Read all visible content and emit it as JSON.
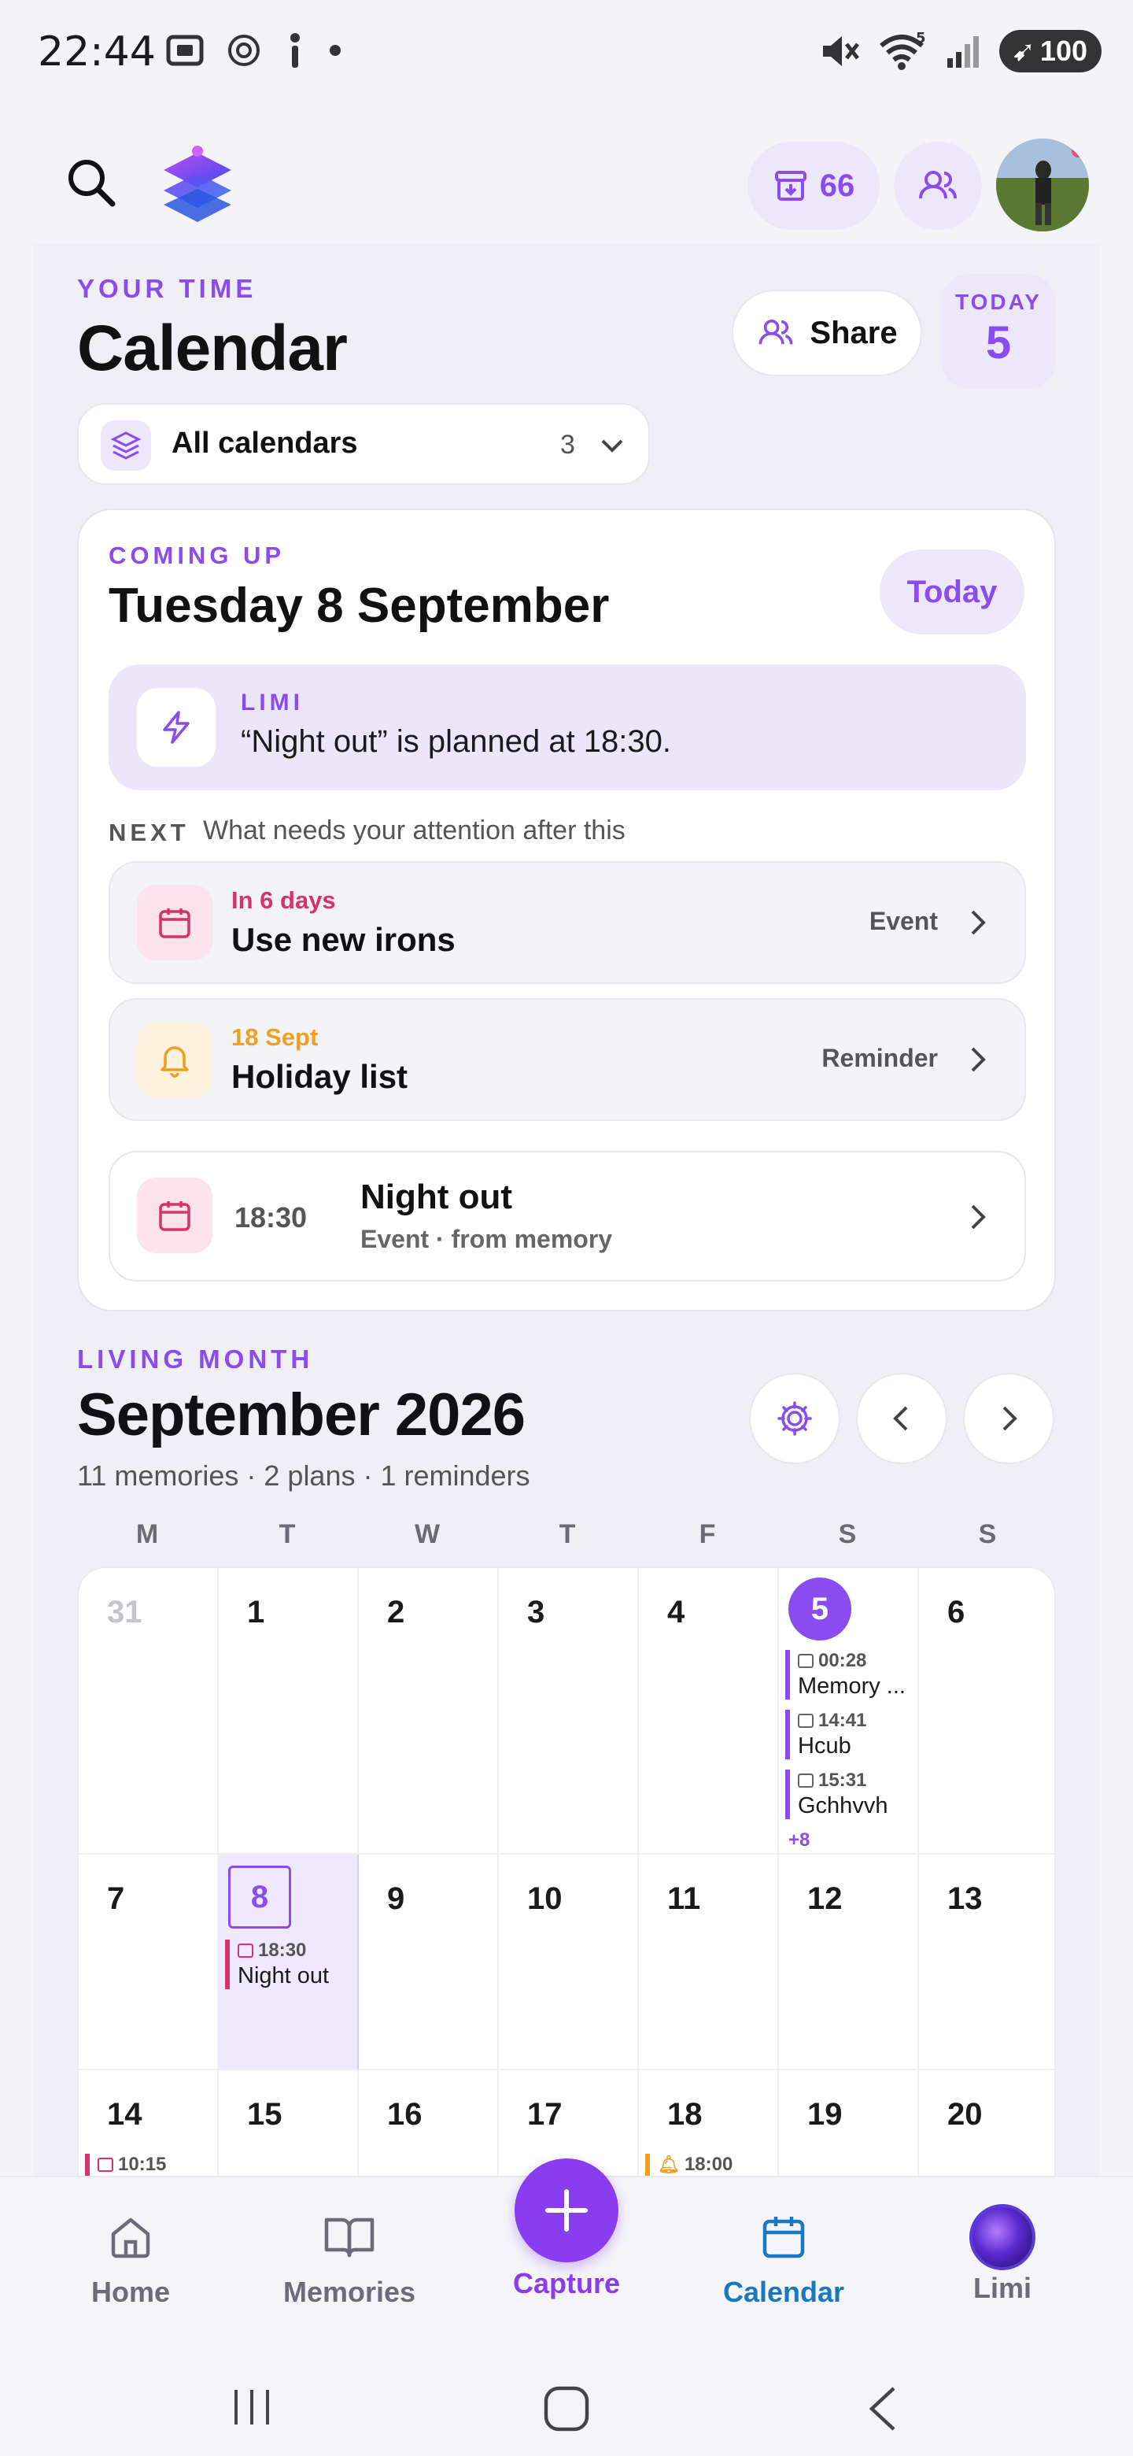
{
  "status": {
    "time": "22:44",
    "battery": "100",
    "wifi_badge": "5"
  },
  "header": {
    "archive_count": "66"
  },
  "hero": {
    "eyebrow": "YOUR TIME",
    "title": "Calendar",
    "share_label": "Share",
    "today_label": "TODAY",
    "today_num": "5",
    "calendar_selector": {
      "label": "All calendars",
      "count": "3"
    }
  },
  "coming_up": {
    "eyebrow": "COMING UP",
    "date": "Tuesday 8 September",
    "today_button": "Today",
    "limi": {
      "label": "LIMI",
      "message": "“Night out” is planned at 18:30."
    },
    "next_label": "NEXT",
    "next_sub": "What needs your attention after this",
    "items": [
      {
        "when": "In 6 days",
        "title": "Use new irons",
        "kind": "Event",
        "color": "#d6336c",
        "icon": "calendar-icon"
      },
      {
        "when": "18 Sept",
        "title": "Holiday list",
        "kind": "Reminder",
        "color": "#f0a020",
        "icon": "bell-icon"
      }
    ],
    "featured": {
      "time": "18:30",
      "title": "Night out",
      "sub": "Event · from memory"
    }
  },
  "living_month": {
    "eyebrow": "LIVING MONTH",
    "title": "September 2026",
    "summary": "11 memories · 2 plans · 1 reminders",
    "weekdays": [
      "M",
      "T",
      "W",
      "T",
      "F",
      "S",
      "S"
    ],
    "week1": [
      "31",
      "1",
      "2",
      "3",
      "4",
      "5",
      "6"
    ],
    "week2": [
      "7",
      "8",
      "9",
      "10",
      "11",
      "12",
      "13"
    ],
    "week3": [
      "14",
      "15",
      "16",
      "17",
      "18",
      "19",
      "20"
    ],
    "sat5_events": [
      {
        "time": "00:28",
        "name": "Memory ..."
      },
      {
        "time": "14:41",
        "name": "Hcub"
      },
      {
        "time": "15:31",
        "name": "Gchhvvh"
      }
    ],
    "sat5_more": "+8",
    "tue8_event": {
      "time": "18:30",
      "name": "Night out"
    },
    "mon14_event": {
      "time": "10:15"
    },
    "fri18_event": {
      "time": "18:00"
    }
  },
  "nav": {
    "home": "Home",
    "memories": "Memories",
    "capture": "Capture",
    "calendar": "Calendar",
    "limi": "Limi"
  },
  "colors": {
    "accent": "#8a4cf0",
    "active_nav": "#1a78c2",
    "event_pink": "#d6336c",
    "reminder_orange": "#f0a020"
  }
}
